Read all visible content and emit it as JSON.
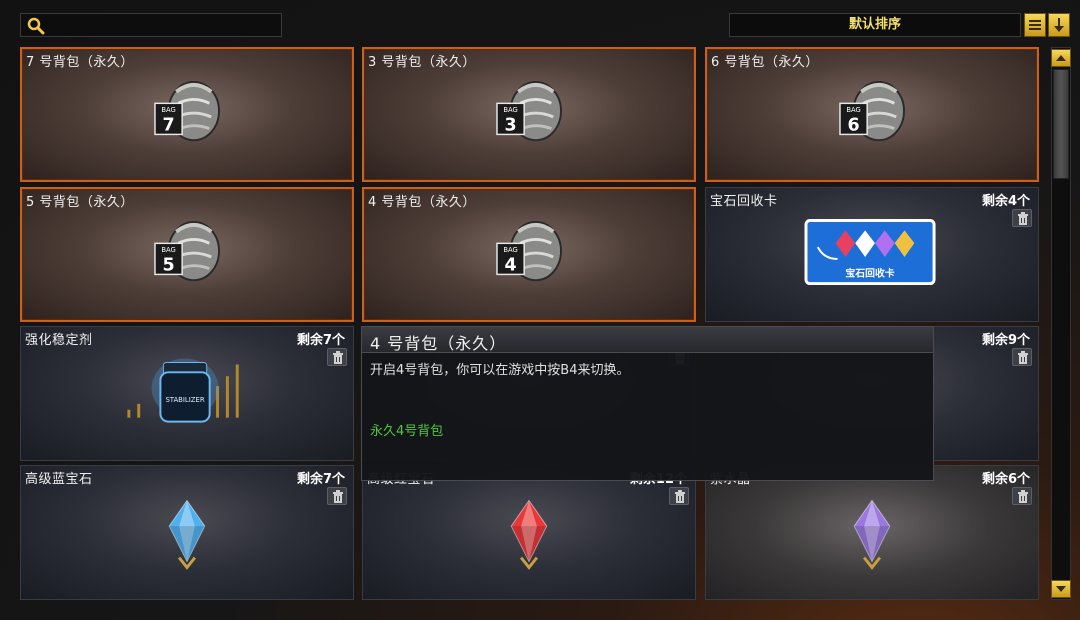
{
  "search": {
    "placeholder": ""
  },
  "sort": {
    "label": "默认排序"
  },
  "items": [
    {
      "name": "7 号背包（永久）",
      "bag_number": "7",
      "count": "",
      "owned": true
    },
    {
      "name": "3 号背包（永久）",
      "bag_number": "3",
      "count": "",
      "owned": true
    },
    {
      "name": "6 号背包（永久）",
      "bag_number": "6",
      "count": "",
      "owned": true
    },
    {
      "name": "5 号背包（永久）",
      "bag_number": "5",
      "count": "",
      "owned": true
    },
    {
      "name": "4 号背包（永久）",
      "bag_number": "4",
      "count": "",
      "owned": true
    },
    {
      "name": "宝石回收卡",
      "count": "剩余4个",
      "card_text": "宝石回收卡"
    },
    {
      "name": "强化稳定剂",
      "count": "剩余7个",
      "jar_label": "STABILIZER"
    },
    {
      "name": "",
      "count": ""
    },
    {
      "name": "",
      "count": "剩余9个"
    },
    {
      "name": "高级蓝宝石",
      "count": "剩余7个",
      "gem_color": "#4fb0f0"
    },
    {
      "name": "高级红宝石",
      "count": "剩余12个",
      "gem_color": "#e8383a"
    },
    {
      "name": "紫水晶",
      "count": "剩余6个",
      "gem_color": "#9a78e0"
    }
  ],
  "tooltip": {
    "title": "4 号背包（永久）",
    "description": "开启4号背包，你可以在游戏中按B4来切换。",
    "duration": "永久4号背包",
    "duration_color": "#4ec83a"
  },
  "colors": {
    "accent": "#f5d85a",
    "owned_border": "#c8601e"
  },
  "icons": [
    "search-icon",
    "list-icon",
    "sort-down-icon",
    "trash-icon",
    "scroll-up-icon",
    "scroll-down-icon"
  ]
}
